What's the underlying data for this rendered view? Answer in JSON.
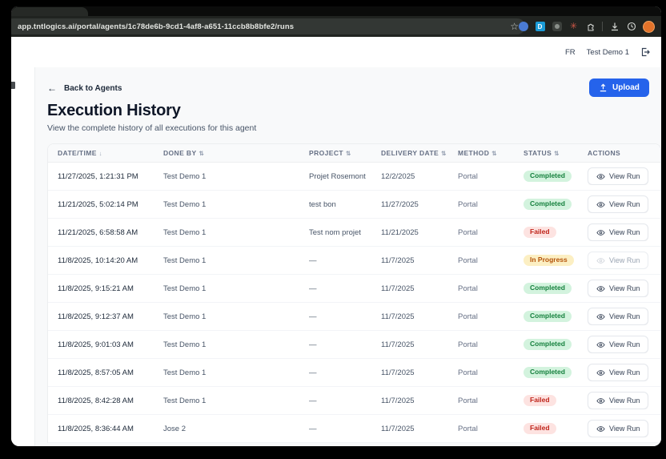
{
  "browser": {
    "url": "app.tntlogics.ai/portal/agents/1c78de6b-9cd1-4af8-a651-11ccb8b8bfe2/runs",
    "toolbar_icons": [
      "bookmark-star-icon",
      "extension-blue-icon",
      "extension-d-icon",
      "extension-camera-icon",
      "extension-red-icon",
      "puzzle-icon",
      "download-icon",
      "history-icon",
      "profile-avatar"
    ]
  },
  "app_header": {
    "language": "FR",
    "user": "Test Demo 1",
    "logout_icon": "logout-icon"
  },
  "page": {
    "back_label": "Back to Agents",
    "upload_label": "Upload",
    "title": "Execution History",
    "subtitle": "View the complete history of all executions for this agent"
  },
  "table": {
    "columns": [
      {
        "label": "DATE/TIME",
        "sort": "desc"
      },
      {
        "label": "DONE BY",
        "sort": "both"
      },
      {
        "label": "PROJECT",
        "sort": "both"
      },
      {
        "label": "DELIVERY DATE",
        "sort": "both"
      },
      {
        "label": "METHOD",
        "sort": "both"
      },
      {
        "label": "STATUS",
        "sort": "both"
      },
      {
        "label": "ACTIONS",
        "sort": "none"
      }
    ],
    "action_label": "View Run",
    "rows": [
      {
        "datetime": "11/27/2025, 1:21:31 PM",
        "done_by": "Test Demo 1",
        "project": "Projet Rosemont",
        "delivery_date": "12/2/2025",
        "method": "Portal",
        "status": "Completed",
        "status_type": "completed"
      },
      {
        "datetime": "11/21/2025, 5:02:14 PM",
        "done_by": "Test Demo 1",
        "project": "test bon",
        "delivery_date": "11/27/2025",
        "method": "Portal",
        "status": "Completed",
        "status_type": "completed"
      },
      {
        "datetime": "11/21/2025, 6:58:58 AM",
        "done_by": "Test Demo 1",
        "project": "Test nom projet",
        "delivery_date": "11/21/2025",
        "method": "Portal",
        "status": "Failed",
        "status_type": "failed"
      },
      {
        "datetime": "11/8/2025, 10:14:20 AM",
        "done_by": "Test Demo 1",
        "project": "—",
        "delivery_date": "11/7/2025",
        "method": "Portal",
        "status": "In Progress",
        "status_type": "in_progress"
      },
      {
        "datetime": "11/8/2025, 9:15:21 AM",
        "done_by": "Test Demo 1",
        "project": "—",
        "delivery_date": "11/7/2025",
        "method": "Portal",
        "status": "Completed",
        "status_type": "completed"
      },
      {
        "datetime": "11/8/2025, 9:12:37 AM",
        "done_by": "Test Demo 1",
        "project": "—",
        "delivery_date": "11/7/2025",
        "method": "Portal",
        "status": "Completed",
        "status_type": "completed"
      },
      {
        "datetime": "11/8/2025, 9:01:03 AM",
        "done_by": "Test Demo 1",
        "project": "—",
        "delivery_date": "11/7/2025",
        "method": "Portal",
        "status": "Completed",
        "status_type": "completed"
      },
      {
        "datetime": "11/8/2025, 8:57:05 AM",
        "done_by": "Test Demo 1",
        "project": "—",
        "delivery_date": "11/7/2025",
        "method": "Portal",
        "status": "Completed",
        "status_type": "completed"
      },
      {
        "datetime": "11/8/2025, 8:42:28 AM",
        "done_by": "Test Demo 1",
        "project": "—",
        "delivery_date": "11/7/2025",
        "method": "Portal",
        "status": "Failed",
        "status_type": "failed"
      },
      {
        "datetime": "11/8/2025, 8:36:44 AM",
        "done_by": "Jose 2",
        "project": "—",
        "delivery_date": "11/7/2025",
        "method": "Portal",
        "status": "Failed",
        "status_type": "failed"
      }
    ]
  },
  "colors": {
    "accent_blue": "#2563eb",
    "completed_bg": "#d3f3de",
    "completed_text": "#15803d",
    "failed_bg": "#fde3e1",
    "failed_text": "#c0261c",
    "in_progress_bg": "#fcefc3",
    "in_progress_text": "#b45309",
    "avatar_orange": "#e2722a"
  }
}
